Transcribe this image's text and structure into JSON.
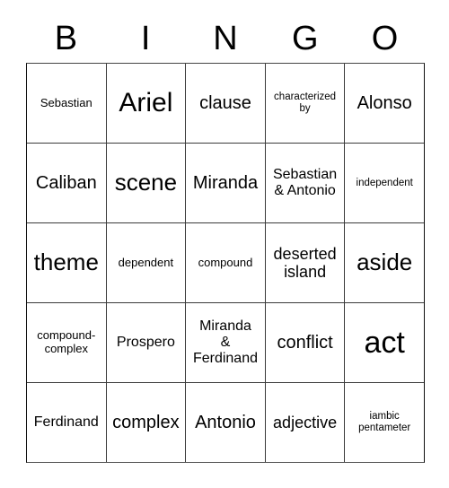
{
  "card": {
    "title_letters": [
      "B",
      "I",
      "N",
      "G",
      "O"
    ],
    "grid": {
      "columns": 5,
      "rows": 5,
      "border_color": "#3a3a3a",
      "background": "#ffffff",
      "text_color": "#000000",
      "cells": [
        [
          {
            "text": "Sebastian",
            "size": "s"
          },
          {
            "text": "Ariel",
            "size": "huge"
          },
          {
            "text": "clause",
            "size": "xl"
          },
          {
            "text": "characterized\nby",
            "size": "xs"
          },
          {
            "text": "Alonso",
            "size": "xl"
          }
        ],
        [
          {
            "text": "Caliban",
            "size": "xl"
          },
          {
            "text": "scene",
            "size": "xxl"
          },
          {
            "text": "Miranda",
            "size": "xl"
          },
          {
            "text": "Sebastian\n& Antonio",
            "size": "m"
          },
          {
            "text": "independent",
            "size": "xs"
          }
        ],
        [
          {
            "text": "theme",
            "size": "xxl"
          },
          {
            "text": "dependent",
            "size": "s"
          },
          {
            "text": "compound",
            "size": "s"
          },
          {
            "text": "deserted\nisland",
            "size": "l"
          },
          {
            "text": "aside",
            "size": "xxl"
          }
        ],
        [
          {
            "text": "compound-\ncomplex",
            "size": "s"
          },
          {
            "text": "Prospero",
            "size": "m"
          },
          {
            "text": "Miranda\n&\nFerdinand",
            "size": "m"
          },
          {
            "text": "conflict",
            "size": "xl"
          },
          {
            "text": "act",
            "size": "mega"
          }
        ],
        [
          {
            "text": "Ferdinand",
            "size": "m"
          },
          {
            "text": "complex",
            "size": "xl"
          },
          {
            "text": "Antonio",
            "size": "xl"
          },
          {
            "text": "adjective",
            "size": "l"
          },
          {
            "text": "iambic\npentameter",
            "size": "xs"
          }
        ]
      ]
    }
  }
}
